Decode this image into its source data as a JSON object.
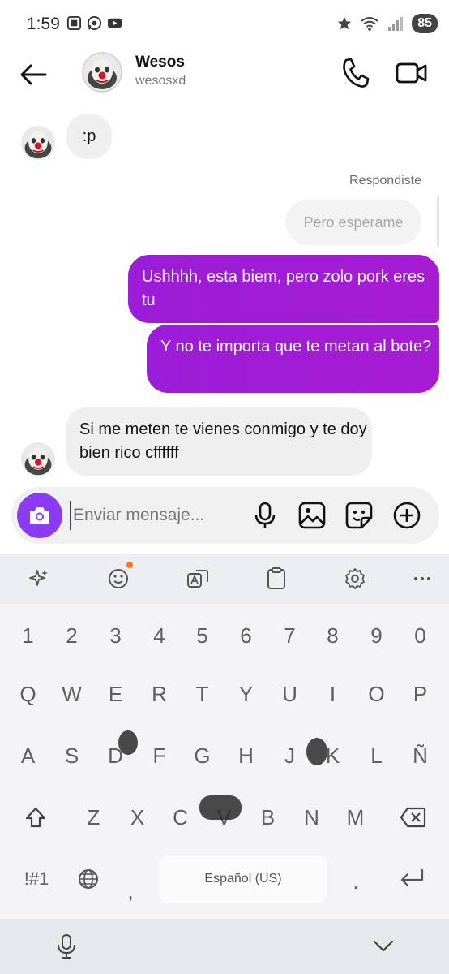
{
  "status_bar": {
    "time": "1:59",
    "battery": "85"
  },
  "header": {
    "name": "Wesos",
    "handle": "wesosxd"
  },
  "messages": {
    "first_incoming": ":p",
    "replied_label": "Respondiste",
    "reply_quote": "Pero esperame",
    "outgoing_1": "Ushhhh, esta biem, pero zolo pork eres tu",
    "outgoing_2": "Y no te importa que te metan al bote?",
    "last_incoming": "Si me meten te vienes conmigo y te doy bien rico cffffff"
  },
  "composer": {
    "placeholder": "Enviar mensaje..."
  },
  "keyboard": {
    "number_row": [
      "1",
      "2",
      "3",
      "4",
      "5",
      "6",
      "7",
      "8",
      "9",
      "0"
    ],
    "row1": [
      "Q",
      "W",
      "E",
      "R",
      "T",
      "Y",
      "U",
      "I",
      "O",
      "P"
    ],
    "row2": [
      "A",
      "S",
      "D",
      "F",
      "G",
      "H",
      "J",
      "K",
      "L",
      "Ñ"
    ],
    "row3": [
      "Z",
      "X",
      "C",
      "V",
      "B",
      "N",
      "M"
    ],
    "symbols_key": "!#1",
    "comma": ",",
    "space_label": "Español (US)",
    "period": "."
  },
  "colors": {
    "outgoing_bubble": "#9b1dd8",
    "camera_button": "#8a3cf5",
    "incoming_bubble": "#efefef",
    "notification_dot": "#f07a1a"
  }
}
